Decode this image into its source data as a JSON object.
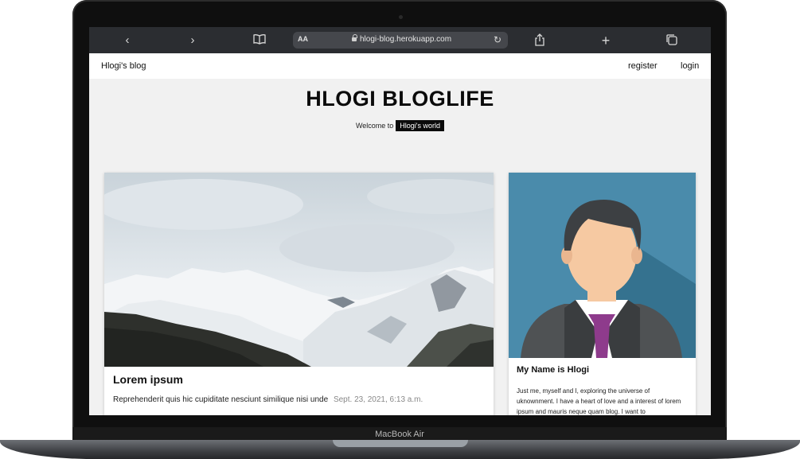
{
  "device": {
    "label": "MacBook Air"
  },
  "browser": {
    "address_text": "hlogi-blog.herokuapp.com",
    "reader_label": "AA",
    "icons": [
      "back-icon",
      "forward-icon",
      "book-icon",
      "lock-icon",
      "reload-icon",
      "share-icon",
      "plus-icon",
      "tabs-icon"
    ]
  },
  "nav": {
    "brand": "Hlogi's blog",
    "register": "register",
    "login": "login"
  },
  "hero": {
    "title": "HLOGI BLOGLIFE",
    "welcome": "Welcome to",
    "highlight": "Hlogi's world"
  },
  "post": {
    "title": "Lorem ipsum",
    "excerpt": "Reprehenderit quis hic cupiditate nesciunt similique nisi unde",
    "date": "Sept. 23, 2021, 6:13 a.m."
  },
  "about": {
    "title": "My Name is Hlogi",
    "text": "Just me, myself and I, exploring the universe of uknownment. I have a heart of love and a interest of lorem ipsum and mauris neque quam blog. I want to"
  },
  "colors": {
    "page_bg": "#f1f1f1",
    "toolbar": "#2b2d31",
    "avatar_bg": "#4a8bab",
    "tie": "#8e3b8c"
  }
}
